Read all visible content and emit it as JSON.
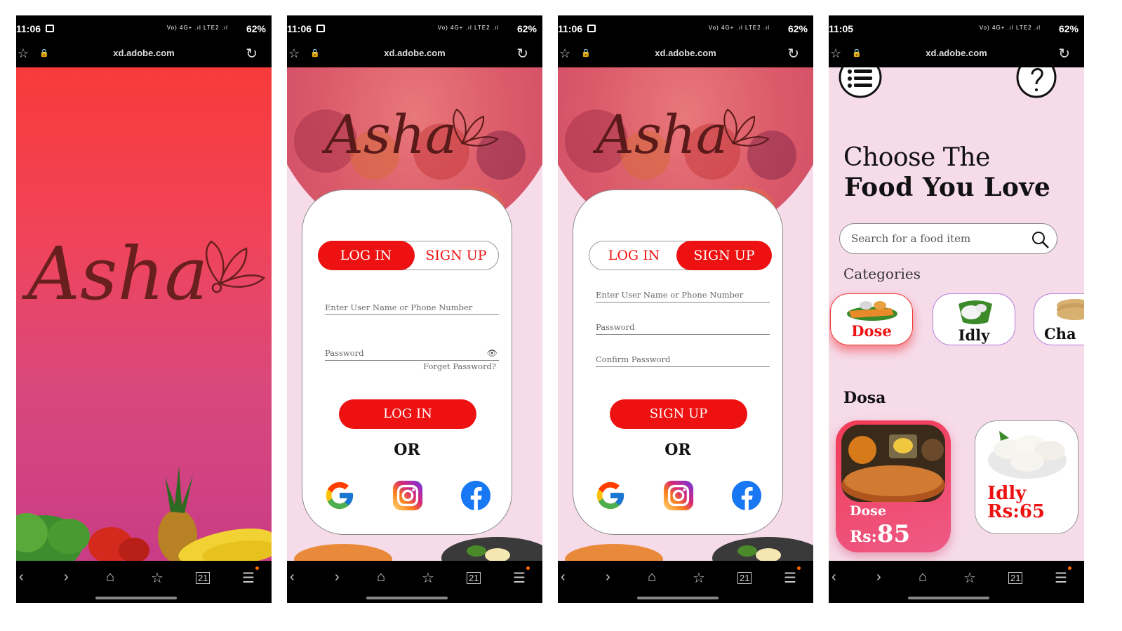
{
  "status_bar": {
    "screens": [
      {
        "time": "11:06",
        "battery": "62%"
      },
      {
        "time": "11:06",
        "battery": "62%"
      },
      {
        "time": "11:06",
        "battery": "62%"
      },
      {
        "time": "11:05",
        "battery": "62%"
      }
    ],
    "network": "Vo) 4G+ .ıl LTE2 .ıl"
  },
  "browser": {
    "url": "xd.adobe.com",
    "tab_count": "21"
  },
  "splash": {
    "logo_text": "Asha"
  },
  "login": {
    "logo_text": "Asha",
    "tab_login": "LOG IN",
    "tab_signup": "SIGN UP",
    "username_placeholder": "Enter User Name or Phone Number",
    "password_placeholder": "Password",
    "forgot_link": "Forget Password?",
    "submit_label": "LOG IN",
    "or_label": "OR",
    "social": [
      "google-icon",
      "instagram-icon",
      "facebook-icon"
    ]
  },
  "signup": {
    "logo_text": "Asha",
    "tab_login": "LOG IN",
    "tab_signup": "SIGN UP",
    "username_placeholder": "Enter User Name or Phone Number",
    "password_placeholder": "Password",
    "confirm_placeholder": "Confirm Password",
    "submit_label": "SIGN UP",
    "or_label": "OR"
  },
  "food": {
    "headline_line1": "Choose The",
    "headline_line2": "Food You Love",
    "search_placeholder": "Search for a food item",
    "categories_title": "Categories",
    "categories": [
      {
        "label": "Dose",
        "selected": true
      },
      {
        "label": "Idly",
        "selected": false
      },
      {
        "label": "Cha",
        "selected": false
      }
    ],
    "section_title": "Dosa",
    "items": [
      {
        "name": "Dose",
        "price_prefix": "Rs:",
        "price": "85"
      },
      {
        "name": "Idly",
        "price_text": "Rs:65"
      }
    ]
  },
  "colors": {
    "accent": "#ee1111",
    "background_pink": "#f6dbe9",
    "category_border": "#b67fd8"
  }
}
